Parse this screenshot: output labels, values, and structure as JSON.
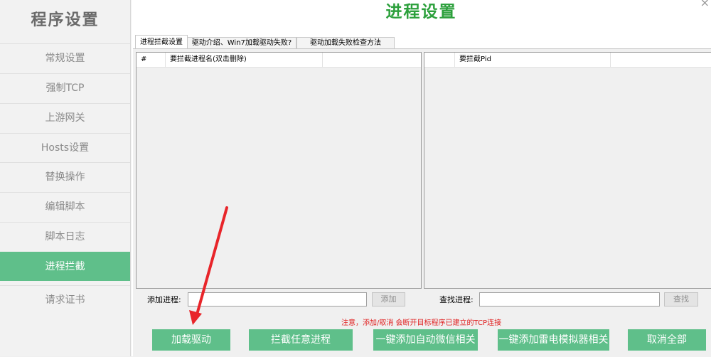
{
  "sidebar": {
    "title": "程序设置",
    "items": [
      {
        "label": "常规设置"
      },
      {
        "label": "强制TCP"
      },
      {
        "label": "上游网关"
      },
      {
        "label": "Hosts设置"
      },
      {
        "label": "替换操作"
      },
      {
        "label": "编辑脚本"
      },
      {
        "label": "脚本日志"
      },
      {
        "label": "进程拦截",
        "active": true
      },
      {
        "label": "请求证书"
      }
    ]
  },
  "main": {
    "title": "进程设置",
    "close_glyph": "×",
    "tabs": [
      {
        "label": "进程拦截设置",
        "active": true
      },
      {
        "label": "驱动介绍、Win7加载驱动失败?"
      },
      {
        "label": "驱动加载失败检查方法"
      }
    ],
    "left_list": {
      "columns": [
        "#",
        "要拦截进程名(双击删除)",
        ""
      ]
    },
    "right_list": {
      "columns": [
        "",
        "要拦截Pid",
        ""
      ]
    },
    "add_process": {
      "label": "添加进程:",
      "value": "",
      "placeholder": "",
      "button": "添加"
    },
    "find_process": {
      "label": "查找进程:",
      "value": "",
      "placeholder": "",
      "button": "查找"
    },
    "notice": "注意，添加/取消 会断开目标程序已建立的TCP连接",
    "buttons": [
      {
        "label": "加载驱动"
      },
      {
        "label": "拦截任意进程"
      },
      {
        "label": "一键添加自动微信相关"
      },
      {
        "label": "一键添加雷电模拟器相关"
      },
      {
        "label": "取消全部"
      }
    ]
  },
  "colors": {
    "accent_green": "#5fbf8a",
    "title_green": "#2ca03c",
    "annotation_red": "#e8252a",
    "notice_red": "#e02020"
  }
}
